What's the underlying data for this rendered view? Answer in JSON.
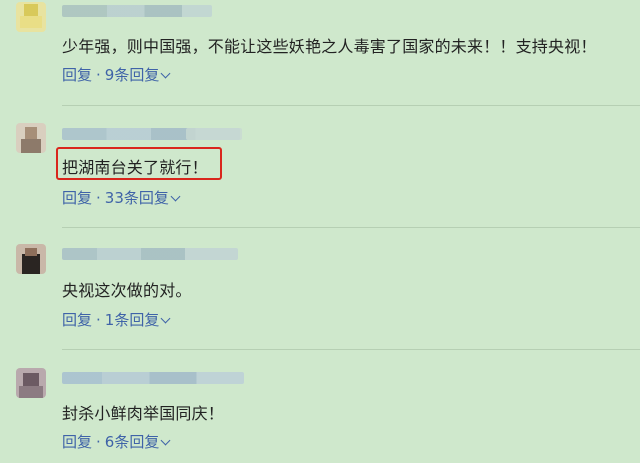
{
  "comments": [
    {
      "text": "少年强，则中国强，不能让这些妖艳之人毒害了国家的未来！！支持央视！",
      "reply_label": "回复",
      "separator": "·",
      "replies_label": "9条回复"
    },
    {
      "text": "把湖南台关了就行！",
      "reply_label": "回复",
      "separator": "·",
      "replies_label": "33条回复"
    },
    {
      "text": "央视这次做的对。",
      "reply_label": "回复",
      "separator": "·",
      "replies_label": "1条回复"
    },
    {
      "text": "封杀小鲜肉举国同庆！",
      "reply_label": "回复",
      "separator": "·",
      "replies_label": "6条回复"
    }
  ],
  "colors": {
    "background": "#cfe8cc",
    "link": "#3f63a8",
    "highlight_border": "#d9261c",
    "divider": "#b6cfb3"
  },
  "icons": {
    "expand": "chevron-down-icon"
  }
}
